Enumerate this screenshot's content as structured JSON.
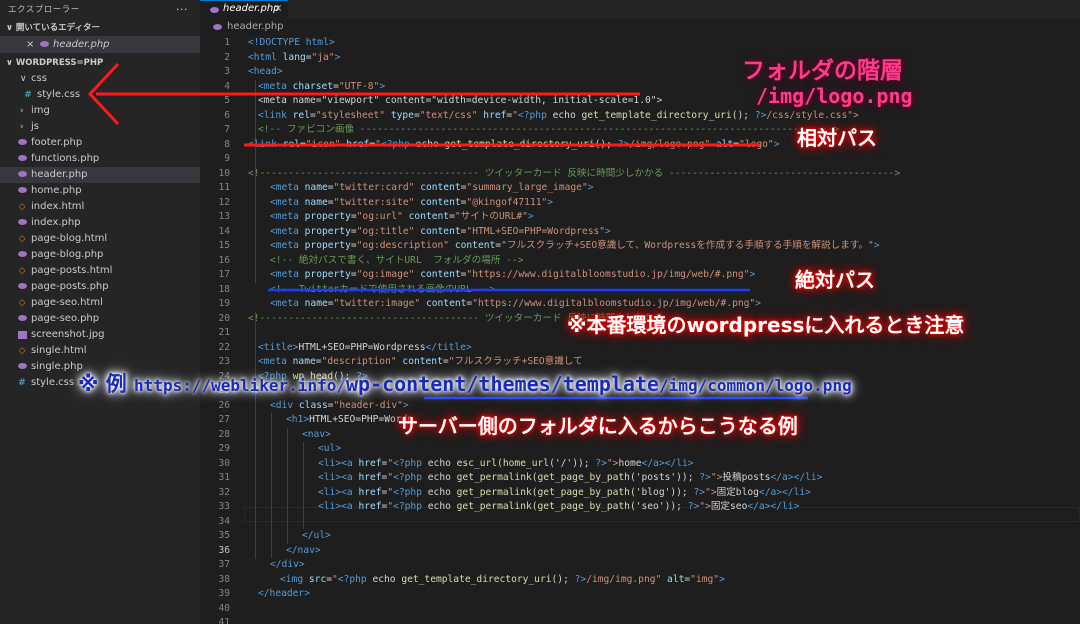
{
  "sidebar": {
    "title": "エクスプローラー",
    "more": "···",
    "open_editors_label": "開いているエディター",
    "open_editor": {
      "close": "×",
      "name": "header.php"
    },
    "workspace_label": "WORDPRESS=PHP",
    "tree": [
      {
        "name": "css",
        "kind": "folder",
        "chevron": "∨"
      },
      {
        "name": "style.css",
        "kind": "css",
        "icon": "#"
      },
      {
        "name": "img",
        "kind": "folder",
        "chevron": "›"
      },
      {
        "name": "js",
        "kind": "folder",
        "chevron": "›"
      },
      {
        "name": "footer.php",
        "kind": "php"
      },
      {
        "name": "functions.php",
        "kind": "php"
      },
      {
        "name": "header.php",
        "kind": "php"
      },
      {
        "name": "home.php",
        "kind": "php"
      },
      {
        "name": "index.html",
        "kind": "html",
        "icon": "◇"
      },
      {
        "name": "index.php",
        "kind": "php"
      },
      {
        "name": "page-blog.html",
        "kind": "html",
        "icon": "◇"
      },
      {
        "name": "page-blog.php",
        "kind": "php"
      },
      {
        "name": "page-posts.html",
        "kind": "html",
        "icon": "◇"
      },
      {
        "name": "page-posts.php",
        "kind": "php"
      },
      {
        "name": "page-seo.html",
        "kind": "html",
        "icon": "◇"
      },
      {
        "name": "page-seo.php",
        "kind": "php"
      },
      {
        "name": "screenshot.jpg",
        "kind": "img"
      },
      {
        "name": "single.html",
        "kind": "html",
        "icon": "◇"
      },
      {
        "name": "single.php",
        "kind": "php"
      },
      {
        "name": "style.css",
        "kind": "css",
        "icon": "#"
      }
    ]
  },
  "editor": {
    "tab": {
      "name": "header.php",
      "close": "×"
    },
    "breadcrumb": "header.php",
    "line_numbers": [
      "1",
      "2",
      "3",
      "4",
      "5",
      "6",
      "7",
      "8",
      "9",
      "10",
      "11",
      "12",
      "13",
      "14",
      "15",
      "16",
      "17",
      "18",
      "19",
      "20",
      "21",
      "22",
      "23",
      "24",
      "25",
      "26",
      "27",
      "28",
      "29",
      "30",
      "31",
      "32",
      "33",
      "34",
      "35",
      "36",
      "37",
      "38",
      "39",
      "40",
      "41"
    ],
    "current_line": "36"
  },
  "code": {
    "l1": "<!DOCTYPE html>",
    "l2a": "<html ",
    "l2b": "lang",
    "l2c": "=",
    "l2d": "\"ja\"",
    "l2e": ">",
    "l3": "<head>",
    "l4a": "<meta ",
    "l4b": "charset",
    "l4c": "=",
    "l4d": "\"UTF-8\"",
    "l4e": ">",
    "l5": "<meta name=\"viewport\" content=\"width=device-width, initial-scale=1.0\">",
    "l6a": "<link ",
    "l6b": "rel",
    "l6c": "=",
    "l6d": "\"stylesheet\"",
    "l6e": " type",
    "l6f": "\"text/css\"",
    "l6g": " href",
    "l6h": "\"",
    "l6i": "<?php",
    "l6j": " echo ",
    "l6k": "get_template_directory_uri",
    "l6l": "(); ",
    "l6m": "?>",
    "l6n": "/css/style.css\">",
    "l7": "<!-- ファビコン画像 ---------------------------------------------------------------------------------->",
    "l8a": "<link ",
    "l8b": "rel",
    "l8c": "\"icon\"",
    "l8d": " href",
    "l8e": "\"",
    "l8f": "<?php",
    "l8g": " echo ",
    "l8h": "get_template_directory_uri",
    "l8i": "(); ",
    "l8j": "?>",
    "l8k": "/img/logo.png\"",
    "l8l": " alt",
    "l8m": "\"logo\"",
    "l8n": ">",
    "l10": "<!-------------------------------------- ツイッターカード 反映に時間少しかかる --------------------------------------->",
    "l11a": "<meta ",
    "l11b": "name",
    "l11c": "\"twitter:card\"",
    "l11d": " content",
    "l11e": "\"summary_large_image\"",
    "l11f": ">",
    "l12a": "<meta ",
    "l12b": "name",
    "l12c": "\"twitter:site\"",
    "l12d": " content",
    "l12e": "\"@kingof47111\"",
    "l12f": ">",
    "l13a": "<meta ",
    "l13b": "property",
    "l13c": "\"og:url\"",
    "l13d": " content",
    "l13e": "\"サイトのURL#\"",
    "l13f": ">",
    "l14a": "<meta ",
    "l14b": "property",
    "l14c": "\"og:title\"",
    "l14d": " content",
    "l14e": "\"HTML+SEO=PHP=Wordpress\"",
    "l14f": ">",
    "l15a": "<meta ",
    "l15b": "property",
    "l15c": "\"og:description\"",
    "l15d": " content",
    "l15e": "\"フルスクラッチ+SEO意識して、Wordpressを作成する手順する手順を解説します。\"",
    "l15f": ">",
    "l16": "<!-- 絶対パスで書く、サイトURL  フォルダの場所 -->",
    "l17a": "<meta ",
    "l17b": "property",
    "l17c": "\"og:image\"",
    "l17d": " content",
    "l17e": "\"https://www.digitalbloomstudio.jp/img/web/#.png\"",
    "l17f": ">",
    "l18": "<!-- Twitterカードで使用される画像のURL -->",
    "l19a": "<meta ",
    "l19b": "name",
    "l19c": "\"twitter:image\"",
    "l19d": " content",
    "l19e": "\"https://www.digitalbloomstudio.jp/img/web/#.png\"",
    "l19f": ">",
    "l20": "<!-------------------------------------- ツイッターカード 反映に時間少しかかる",
    "l22a": "<title>",
    "l22b": "HTML+SEO=PHP=Wordpress",
    "l22c": "</title>",
    "l23a": "<meta ",
    "l23b": "name",
    "l23c": "\"description\"",
    "l23d": " content",
    "l23e": "\"フルスクラッチ+SEO意識して",
    "l24a": "<?php",
    "l24b": " wp_head",
    "l24c": "(); ",
    "l24d": "?>",
    "l25": "<?",
    "l28a": "<div ",
    "l28b": "class",
    "l28c": "\"header-div\"",
    "l28d": ">",
    "l29a": "<h1>",
    "l29b": "HTML+SEO=PHP=Wordp",
    "l30": "<nav>",
    "l31": "<ul>",
    "l32a": "<li><a ",
    "l32b": "href",
    "l32c": "\"",
    "l32d": "<?php",
    "l32e": " echo ",
    "l32f": "esc_url",
    "l32g": "(",
    "l32h": "home_url",
    "l32i": "('/')); ",
    "l32j": "?>",
    "l32k": "\">",
    "l32l": "home",
    "l32m": "</a></li>",
    "l33a": "<li><a ",
    "l33b": "href",
    "l33c": "\"",
    "l33d": "<?php",
    "l33e": " echo ",
    "l33f": "get_permalink",
    "l33g": "(",
    "l33h": "get_page_by_path",
    "l33i": "('posts')); ",
    "l33j": "?>",
    "l33k": "\">",
    "l33l": "投稿posts",
    "l33m": "</a></li>",
    "l34a": "<li><a ",
    "l34b": "href",
    "l34c": "\"",
    "l34d": "<?php",
    "l34e": " echo ",
    "l34f": "get_permalink",
    "l34g": "(",
    "l34h": "get_page_by_path",
    "l34i": "('blog')); ",
    "l34j": "?>",
    "l34k": "\">",
    "l34l": "固定blog",
    "l34m": "</a></li>",
    "l35a": "<li><a ",
    "l35b": "href",
    "l35c": "\"",
    "l35d": "<?php",
    "l35e": " echo ",
    "l35f": "get_permalink",
    "l35g": "(",
    "l35h": "get_page_by_path",
    "l35i": "('seo')); ",
    "l35j": "?>",
    "l35k": "\">",
    "l35l": "固定seo",
    "l35m": "</a></li>",
    "l37": "</ul>",
    "l38": "</nav>",
    "l39": "</div>",
    "l40a": "<img ",
    "l40b": "src",
    "l40c": "\"",
    "l40d": "<?php",
    "l40e": " echo ",
    "l40f": "get_template_directory_uri",
    "l40g": "(); ",
    "l40h": "?>",
    "l40i": "/img/img.png\"",
    "l40j": " alt",
    "l40k": "\"img\"",
    "l40l": ">",
    "l41": "</header>",
    "eq": "="
  },
  "annotations": {
    "folder_hierarchy": "フォルダの階層",
    "folder_path": "/img/logo.png",
    "relative_path": "相対パス",
    "absolute_path": "絶対パス",
    "production_caution": "※本番環境のwordpressに入れるとき注意",
    "example_prefix": "※ 例 ",
    "example_url_a": "https://webliker.info/",
    "example_url_b": "wp-content/themes/template",
    "example_url_c": "/img/common/logo.png",
    "server_side_note": "サーバー側のフォルダに入るからこうなる例"
  },
  "colors": {
    "annotation_red": "#ff1a1a",
    "annotation_blue": "#1a2bb8",
    "underline_blue": "#1a3cff"
  }
}
